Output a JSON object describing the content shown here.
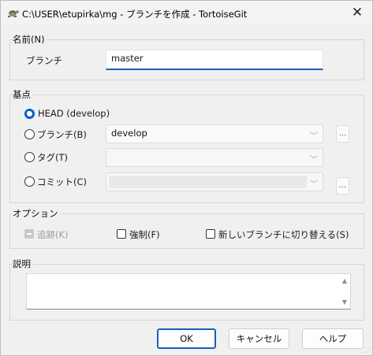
{
  "window": {
    "title": "C:\\USER\\etupirka\\mg - ブランチを作成 - TortoiseGit",
    "close_icon": "close-icon"
  },
  "name_group": {
    "label": "名前(N)",
    "branch_label": "ブランチ",
    "branch_value": "master"
  },
  "base_group": {
    "label": "基点",
    "head_label": "HEAD (develop)",
    "branch_label": "ブランチ(B)",
    "branch_value": "develop",
    "tag_label": "タグ(T)",
    "tag_value": "",
    "commit_label": "コミット(C)",
    "commit_value": "",
    "browse_label": "...",
    "selected": "head"
  },
  "options_group": {
    "label": "オプション",
    "track_label": "追跡(K)",
    "force_label": "強制(F)",
    "switch_label": "新しいブランチに切り替える(S)",
    "track_checked": "indeterminate",
    "force_checked": false,
    "switch_checked": false
  },
  "description_group": {
    "label": "説明",
    "value": ""
  },
  "buttons": {
    "ok": "OK",
    "cancel": "キャンセル",
    "help": "ヘルプ"
  },
  "colors": {
    "accent": "#1a5fb4",
    "radio_selected": "#0062c4"
  }
}
